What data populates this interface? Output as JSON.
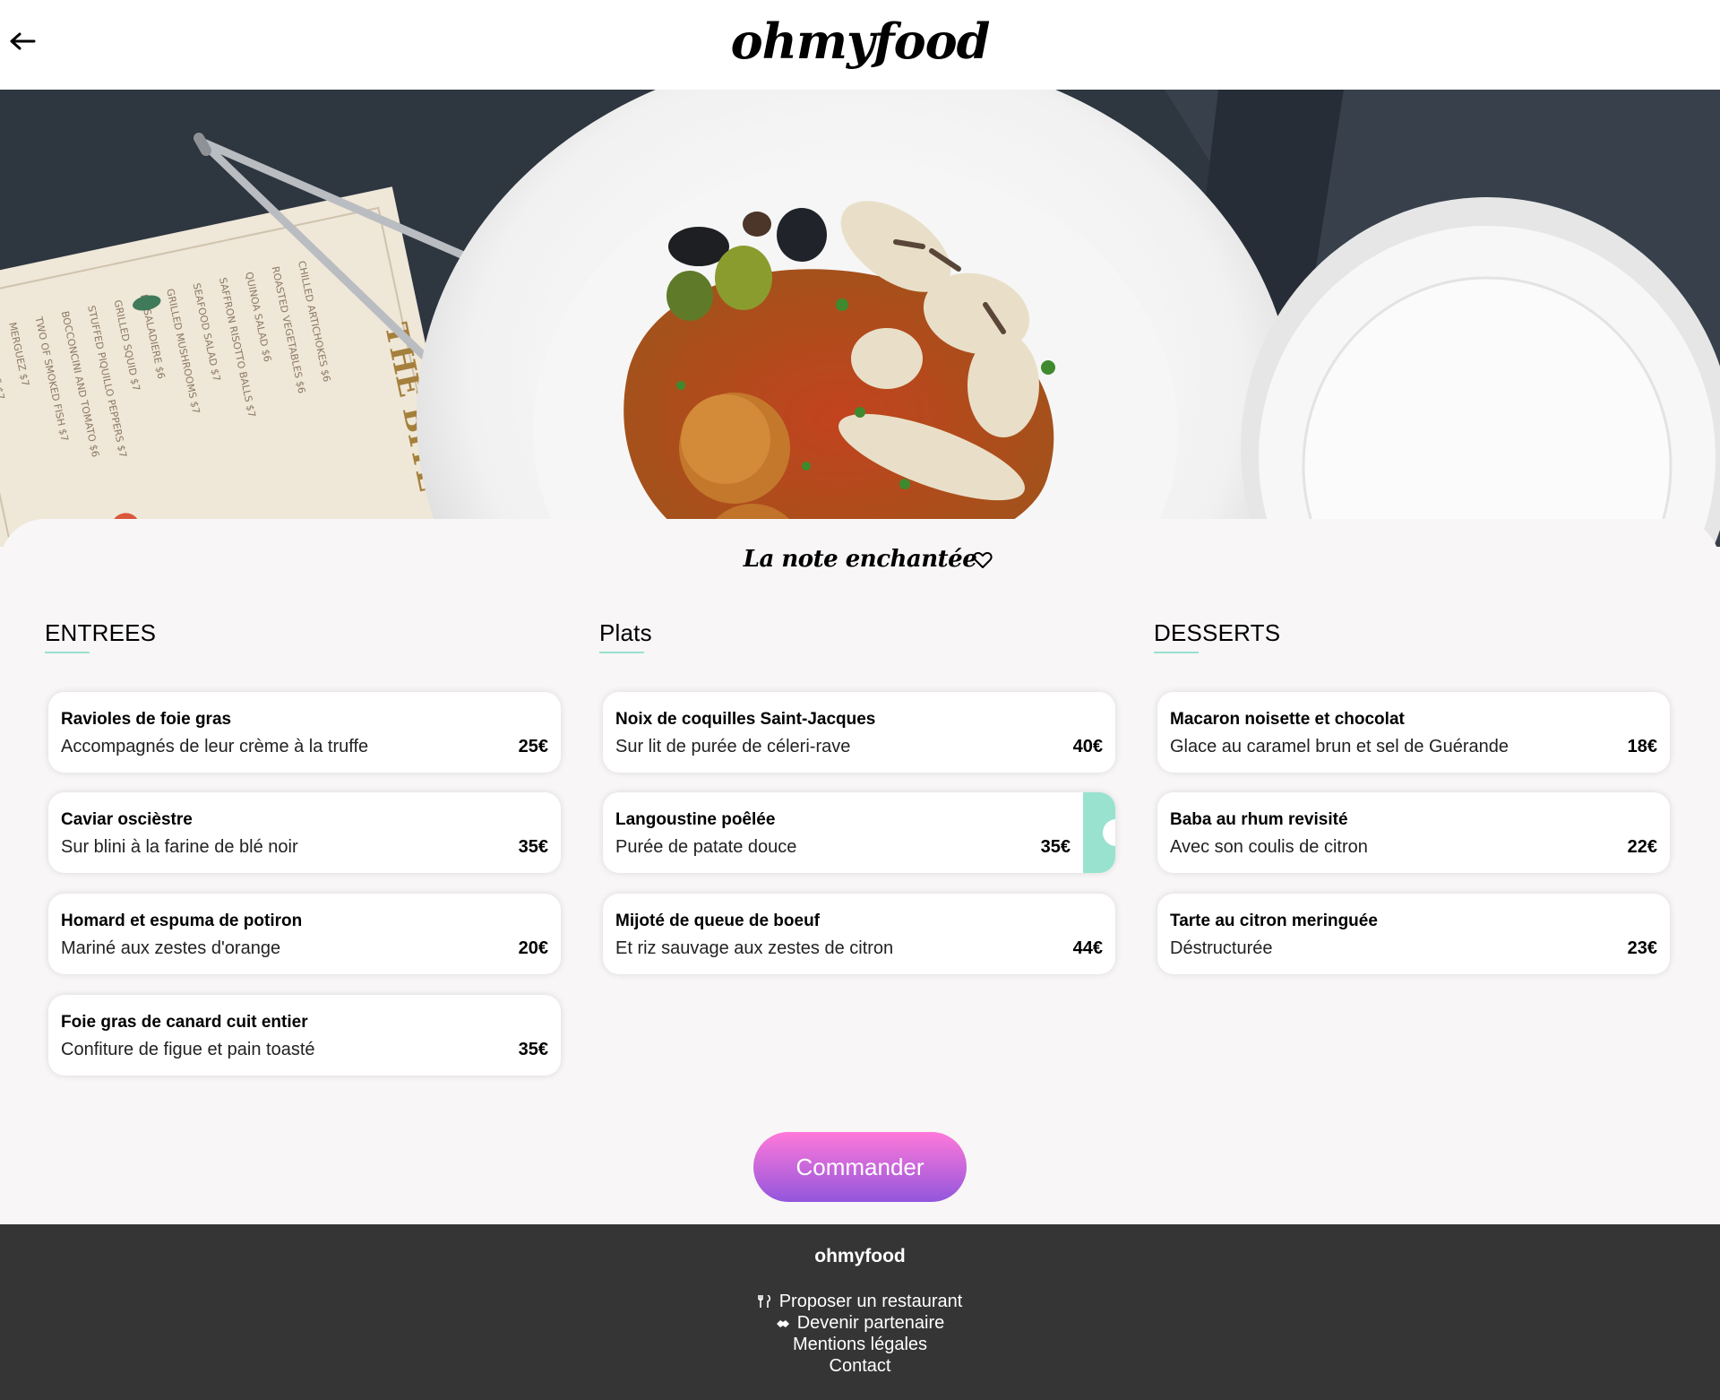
{
  "header": {
    "back_icon": "arrow-left-icon",
    "logo": "ohmyfood"
  },
  "hero": {
    "image": "dish-with-squid-olives-arancini-photo"
  },
  "restaurant": {
    "title": "La note enchantée",
    "favorite_icon": "heart-outline-icon"
  },
  "menu": {
    "entrees": {
      "heading": "ENTREES",
      "items": [
        {
          "name": "Ravioles de foie gras",
          "desc": "Accompagnés de leur crème à la truffe",
          "price": "25€"
        },
        {
          "name": "Caviar oscièstre",
          "desc": "Sur blini à la farine de blé noir",
          "price": "35€"
        },
        {
          "name": "Homard et espuma de potiron",
          "desc": "Mariné aux zestes d'orange",
          "price": "20€"
        },
        {
          "name": "Foie gras de canard cuit entier",
          "desc": "Confiture de figue et pain toasté",
          "price": "35€"
        }
      ]
    },
    "plats": {
      "heading": "Plats",
      "items": [
        {
          "name": "Noix de coquilles Saint-Jacques",
          "desc": "Sur lit de purée de céleri-rave",
          "price": "40€"
        },
        {
          "name": "Langoustine poêlée",
          "desc": "Purée de patate douce",
          "price": "35€"
        },
        {
          "name": "Mijoté de queue de boeuf",
          "desc": "Et riz sauvage aux zestes de citron",
          "price": "44€"
        }
      ]
    },
    "desserts": {
      "heading": "DESSERTS",
      "items": [
        {
          "name": "Macaron noisette et chocolat",
          "desc": "Glace au caramel brun et sel de Guérande",
          "price": "18€"
        },
        {
          "name": "Baba au rhum revisité",
          "desc": "Avec son coulis de citron",
          "price": "22€"
        },
        {
          "name": "Tarte au citron meringuée",
          "desc": "Déstructurée",
          "price": "23€"
        }
      ]
    }
  },
  "order_button": "Commander",
  "footer": {
    "logo": "ohmyfood",
    "links": [
      {
        "label": "Proposer un restaurant",
        "icon": "utensils-icon"
      },
      {
        "label": "Devenir partenaire",
        "icon": "handshake-icon"
      },
      {
        "label": "Mentions légales"
      },
      {
        "label": "Contact"
      }
    ]
  },
  "colors": {
    "accent": "#99e2d0",
    "button_gradient_top": "#ff79da",
    "button_gradient_bottom": "#9356dc",
    "footer_bg": "#353535",
    "page_bg": "#f8f6f6"
  }
}
